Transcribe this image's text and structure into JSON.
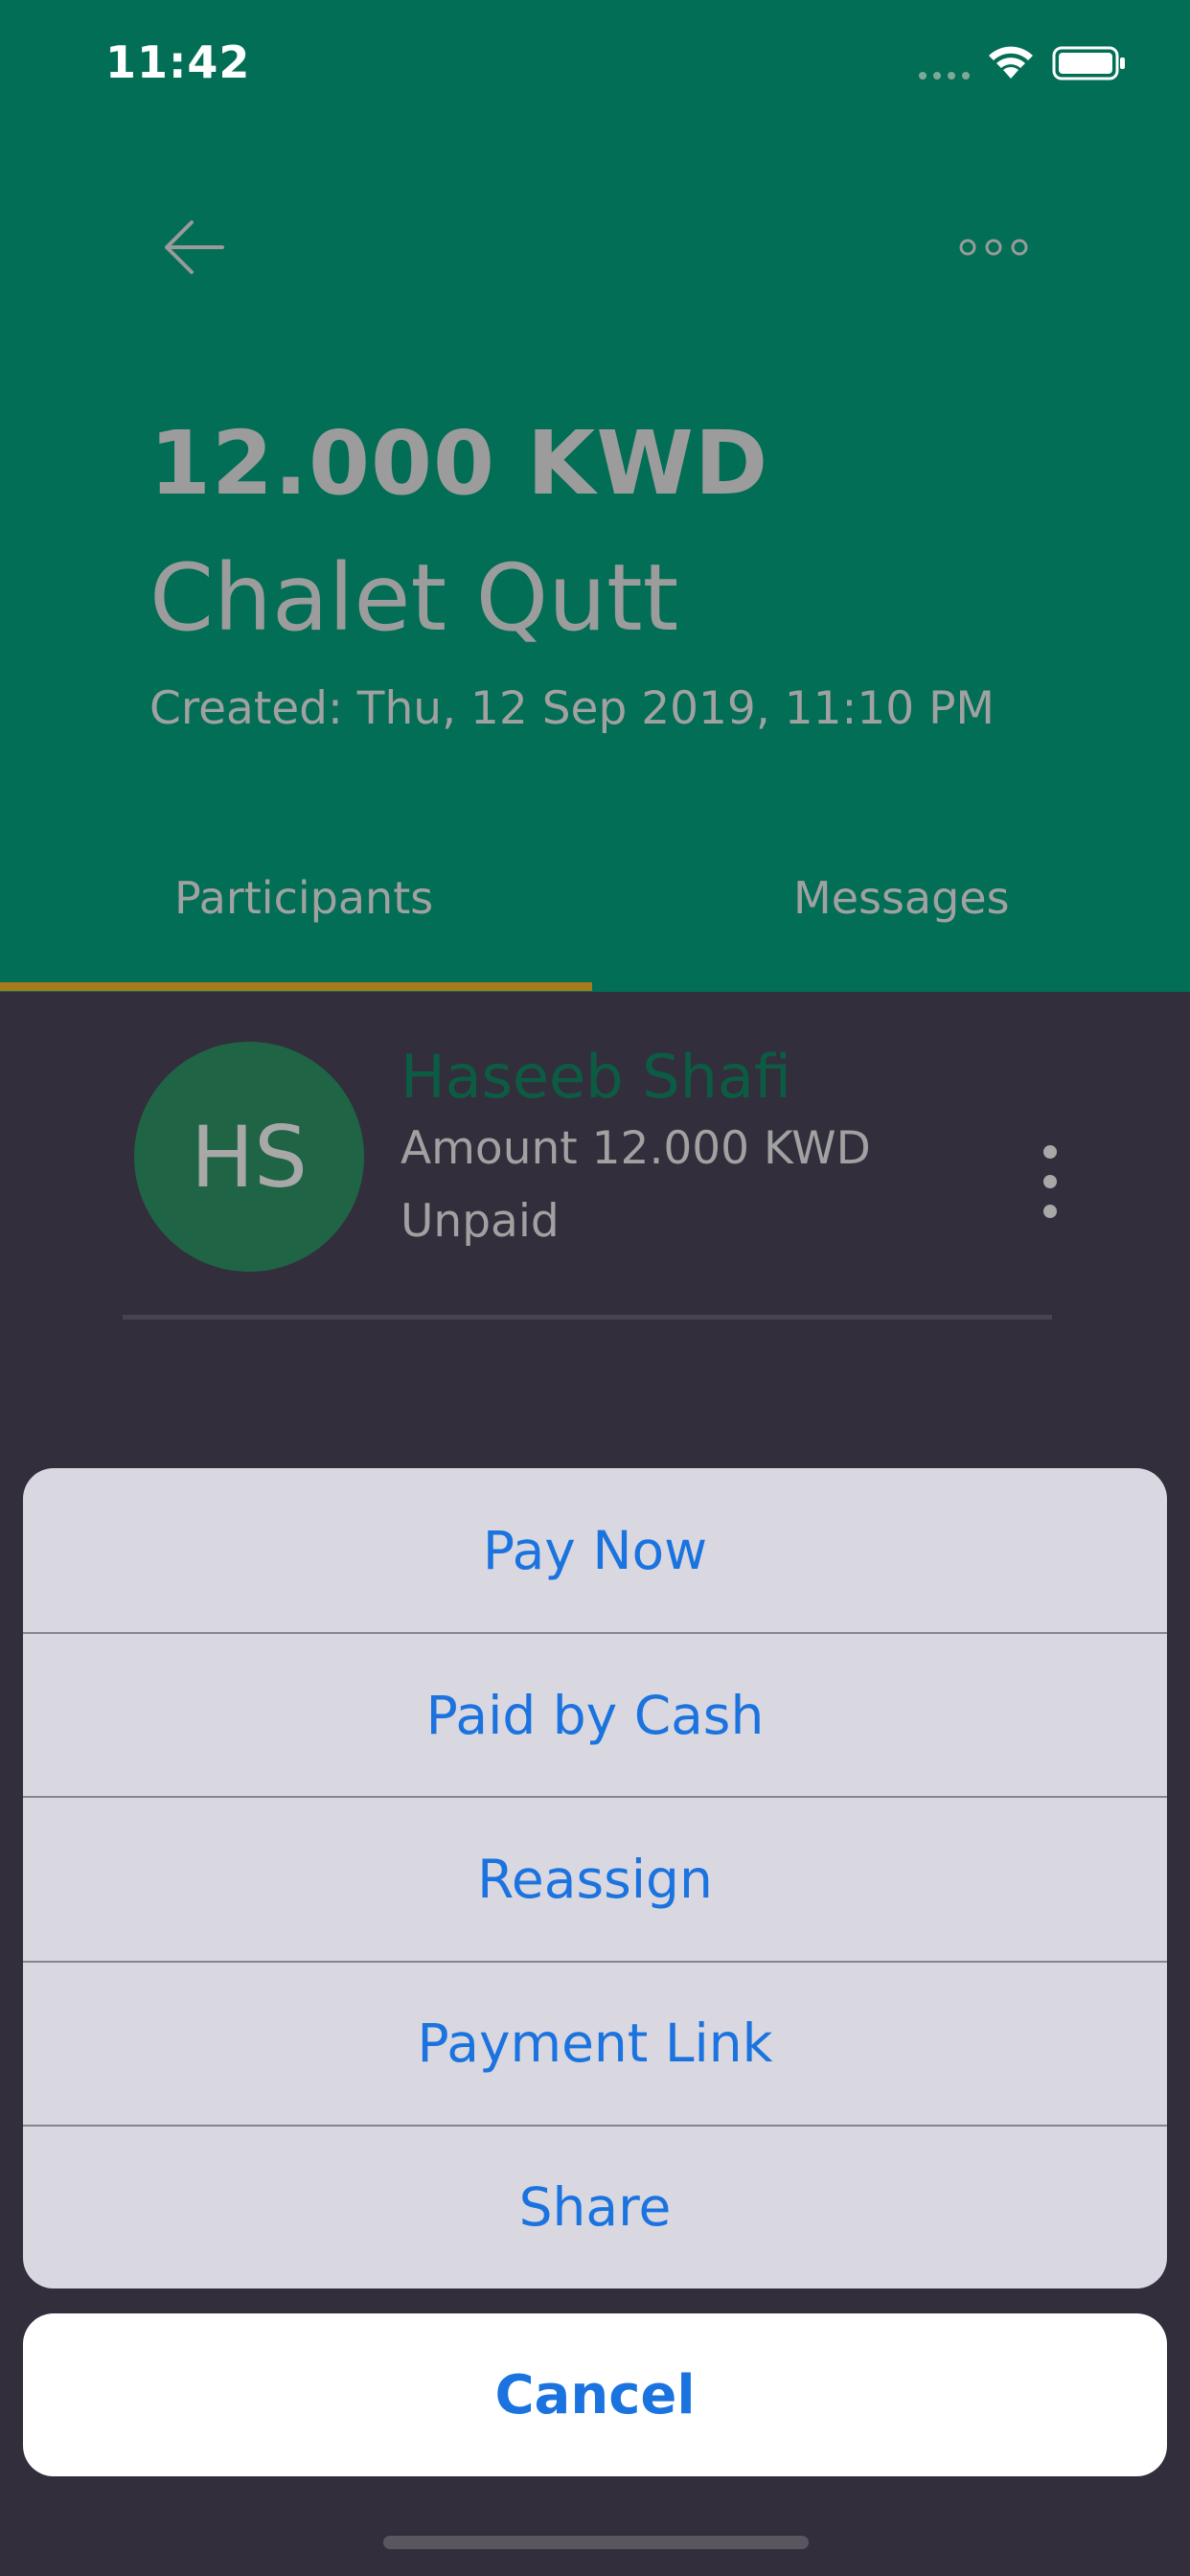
{
  "status_bar": {
    "time": "11:42"
  },
  "header": {
    "amount": "12.000 KWD",
    "title": "Chalet Qutt",
    "created": "Created: Thu, 12 Sep 2019, 11:10 PM"
  },
  "tabs": [
    {
      "label": "Participants",
      "selected": true
    },
    {
      "label": "Messages",
      "selected": false
    }
  ],
  "participant": {
    "initials": "HS",
    "name": "Haseeb Shafi",
    "amount": "Amount 12.000 KWD",
    "status": "Unpaid"
  },
  "action_sheet": {
    "items": [
      {
        "label": "Pay Now"
      },
      {
        "label": "Paid by Cash"
      },
      {
        "label": "Reassign"
      },
      {
        "label": "Payment Link"
      },
      {
        "label": "Share"
      }
    ],
    "cancel_label": "Cancel"
  },
  "colors": {
    "header_bg": "#026e55",
    "body_bg": "#322e3c",
    "tab_indicator": "#a87a1c",
    "avatar_bg": "#1f6545",
    "action_text": "#1a73df"
  },
  "icons": {
    "back": "arrow-left-icon",
    "more": "more-horizontal-icon",
    "row_menu": "more-vertical-icon",
    "wifi": "wifi-icon",
    "battery": "battery-icon",
    "signal": "cellular-signal-icon"
  }
}
